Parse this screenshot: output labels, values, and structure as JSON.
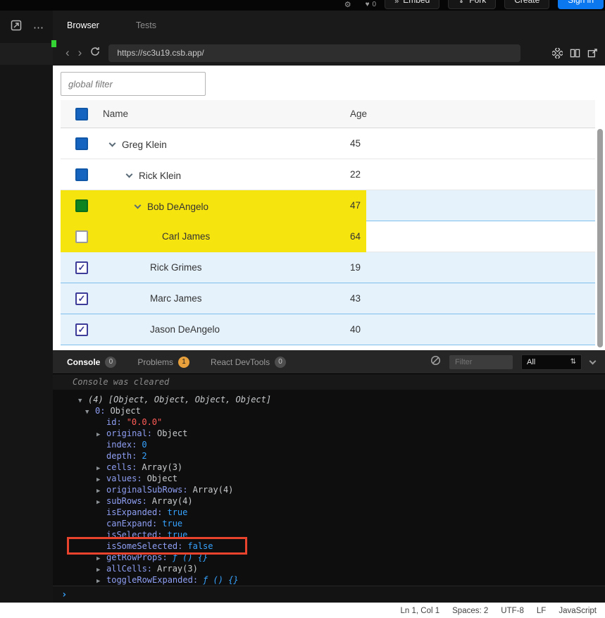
{
  "colors": {
    "highlight_yellow": "#f6e40f",
    "annotation_red": "#e8432d",
    "selected_row_blue": "#e5f2fc",
    "checkbox_blue": "#1565c0",
    "checkbox_green": "#0e8420",
    "signin_blue": "#0b78f0",
    "status_green": "#35d435",
    "problems_badge_orange": "#e8a03c"
  },
  "icons": {
    "checkmark": "✓",
    "heart": "♥",
    "gear": "⚙",
    "ellipsis": "⋯",
    "embed_arrows": "»",
    "back": "‹",
    "forward": "›",
    "updown": "⇅"
  },
  "topbar": {
    "like_count": "0",
    "embed": "Embed",
    "fork": "Fork",
    "create": "Create",
    "sign_in": "Sign in"
  },
  "pane": {
    "tabs": [
      {
        "label": "Browser"
      },
      {
        "label": "Tests"
      }
    ],
    "url": "https://sc3u19.csb.app/"
  },
  "browser": {
    "filter_placeholder": "global filter",
    "table": {
      "columns": [
        "Name",
        "Age"
      ],
      "rows": [
        {
          "name": "Greg Klein",
          "age": "45"
        },
        {
          "name": "Rick Klein",
          "age": "22"
        },
        {
          "name": "Bob DeAngelo",
          "age": "47"
        },
        {
          "name": "Carl James",
          "age": "64"
        },
        {
          "name": "Rick Grimes",
          "age": "19"
        },
        {
          "name": "Marc James",
          "age": "43"
        },
        {
          "name": "Jason DeAngelo",
          "age": "40"
        }
      ]
    }
  },
  "console": {
    "tabs": [
      {
        "label": "Console",
        "badge": "0"
      },
      {
        "label": "Problems",
        "badge": "1"
      },
      {
        "label": "React DevTools",
        "badge": "0"
      }
    ],
    "filter_placeholder": "Filter",
    "level_select": "All",
    "cleared_text": "Console was cleared",
    "prompt": "›",
    "log": [
      {
        "exp": "▼",
        "key": "",
        "value": "(4) [Object, Object, Object, Object]"
      },
      {
        "exp": "▼",
        "key": "0:",
        "value": "Object"
      },
      {
        "exp": "",
        "key": "id:",
        "value": "\"0.0.0\""
      },
      {
        "exp": "▶",
        "key": "original:",
        "value": "Object"
      },
      {
        "exp": "",
        "key": "index:",
        "value": "0"
      },
      {
        "exp": "",
        "key": "depth:",
        "value": "2"
      },
      {
        "exp": "▶",
        "key": "cells:",
        "value": "Array(3)"
      },
      {
        "exp": "▶",
        "key": "values:",
        "value": "Object"
      },
      {
        "exp": "▶",
        "key": "originalSubRows:",
        "value": "Array(4)"
      },
      {
        "exp": "▶",
        "key": "subRows:",
        "value": "Array(4)"
      },
      {
        "exp": "",
        "key": "isExpanded:",
        "value": "true"
      },
      {
        "exp": "",
        "key": "canExpand:",
        "value": "true"
      },
      {
        "exp": "",
        "key": "isSelected:",
        "value": "true"
      },
      {
        "exp": "",
        "key": "isSomeSelected:",
        "value": "false"
      },
      {
        "exp": "▶",
        "key": "getRowProps:",
        "value": "ƒ () {}"
      },
      {
        "exp": "▶",
        "key": "allCells:",
        "value": "Array(3)"
      },
      {
        "exp": "▶",
        "key": "toggleRowExpanded:",
        "value": "ƒ () {}"
      }
    ]
  },
  "statusbar": {
    "items": [
      "Ln 1, Col 1",
      "Spaces: 2",
      "UTF-8",
      "LF",
      "JavaScript"
    ]
  }
}
